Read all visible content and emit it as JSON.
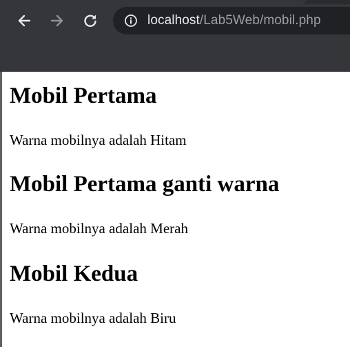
{
  "browser": {
    "url_host": "localhost",
    "url_path": "/Lab5Web/mobil.php",
    "icons": {
      "back": "arrow-left-icon",
      "forward": "arrow-right-icon",
      "reload": "reload-icon",
      "site_info": "info-icon"
    }
  },
  "page": {
    "sections": [
      {
        "title": "Mobil Pertama",
        "text": "Warna mobilnya adalah Hitam"
      },
      {
        "title": "Mobil Pertama ganti warna",
        "text": "Warna mobilnya adalah Merah"
      },
      {
        "title": "Mobil Kedua",
        "text": "Warna mobilnya adalah Biru"
      }
    ]
  },
  "colors": {
    "toolbar_bg": "#35363a",
    "omnibox_bg": "#202124",
    "url_host": "#e8eaed",
    "url_path": "#9aa0a6",
    "page_bg": "#ffffff",
    "text": "#000000"
  }
}
